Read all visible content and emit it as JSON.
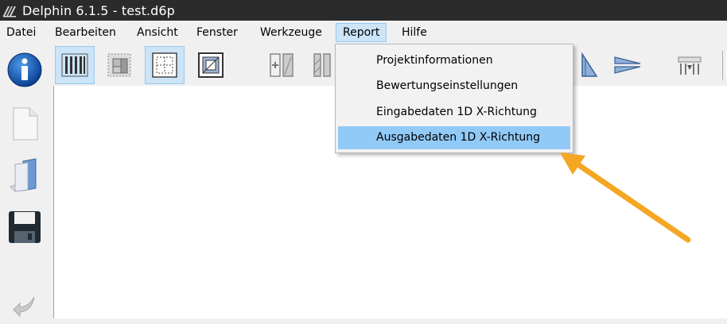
{
  "window": {
    "title": "Delphin 6.1.5 - test.d6p",
    "app_icon": "delphin-logo-icon"
  },
  "menubar": {
    "items": [
      {
        "id": "datei",
        "label": "Datei"
      },
      {
        "id": "bearbeiten",
        "label": "Bearbeiten"
      },
      {
        "id": "ansicht",
        "label": "Ansicht"
      },
      {
        "id": "fenster",
        "label": "Fenster"
      },
      {
        "id": "werkzeuge",
        "label": "Werkzeuge"
      },
      {
        "id": "report",
        "label": "Report",
        "open": true
      },
      {
        "id": "hilfe",
        "label": "Hilfe"
      }
    ]
  },
  "report_menu": {
    "items": [
      {
        "label": "Projektinformationen"
      },
      {
        "label": "Bewertungseinstellungen"
      },
      {
        "label": "Eingabedaten 1D X-Richtung"
      },
      {
        "label": "Ausgabedaten 1D X-Richtung",
        "highlighted": true
      }
    ]
  },
  "toolbar": {
    "buttons": [
      {
        "icon": "vertical-lines-icon",
        "active": true
      },
      {
        "icon": "grid-layout-icon",
        "active": false
      },
      {
        "icon": "dashed-frame-icon",
        "active": true
      },
      {
        "icon": "framed-box-icon",
        "active": false
      },
      {
        "icon": "split-plus-icon",
        "active": false
      },
      {
        "icon": "hatched-columns-icon",
        "active": false
      },
      {
        "icon": "triangle-icon",
        "active": false
      },
      {
        "icon": "wedge-arrow-icon",
        "active": false
      },
      {
        "icon": "columns-down-arrow-icon",
        "active": false
      }
    ]
  },
  "sidebar": {
    "buttons": [
      {
        "icon": "info-icon"
      },
      {
        "icon": "new-document-icon"
      },
      {
        "icon": "open-folder-icon"
      },
      {
        "icon": "save-floppy-icon"
      },
      {
        "icon": "undo-arrow-icon"
      }
    ]
  },
  "colors": {
    "titlebar": "#2b2b2b",
    "menu_active": "#cce4f7",
    "menu_highlight": "#91c9f7",
    "annotation_arrow": "#f5a623"
  }
}
